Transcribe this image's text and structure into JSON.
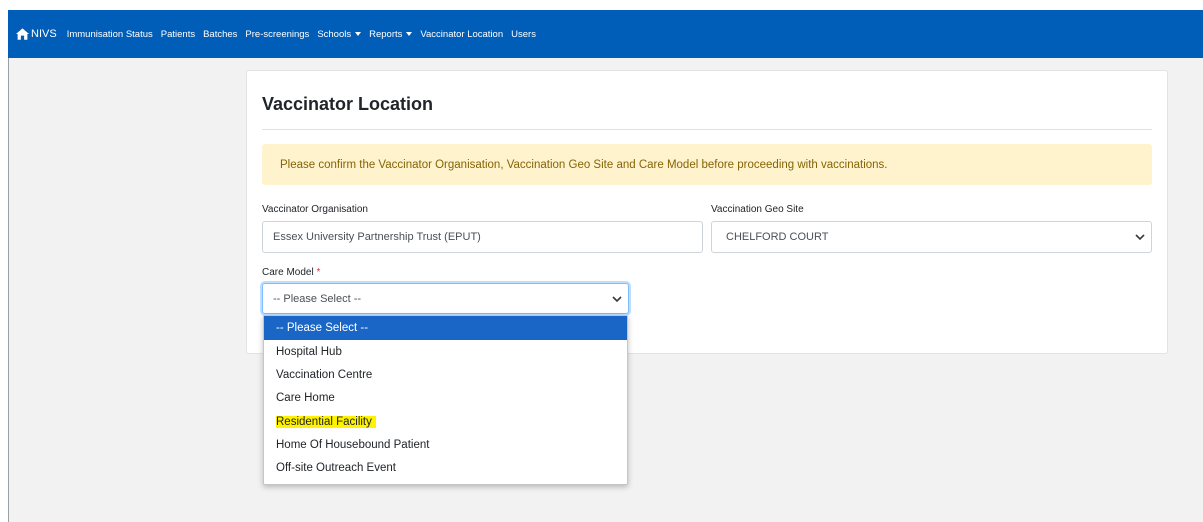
{
  "navbar": {
    "brand": "NIVS",
    "items": [
      {
        "label": "Immunisation Status",
        "dropdown": false
      },
      {
        "label": "Patients",
        "dropdown": false
      },
      {
        "label": "Batches",
        "dropdown": false
      },
      {
        "label": "Pre-screenings",
        "dropdown": false
      },
      {
        "label": "Schools",
        "dropdown": true
      },
      {
        "label": "Reports",
        "dropdown": true
      },
      {
        "label": "Vaccinator Location",
        "dropdown": false
      },
      {
        "label": "Users",
        "dropdown": false
      }
    ],
    "color": "#005eb8"
  },
  "page": {
    "title": "Vaccinator Location",
    "alert": "Please confirm the Vaccinator Organisation, Vaccination Geo Site and Care Model before proceeding with vaccinations."
  },
  "form": {
    "organisation": {
      "label": "Vaccinator Organisation",
      "value": "Essex University Partnership Trust (EPUT)"
    },
    "geo_site": {
      "label": "Vaccination Geo Site",
      "value": "CHELFORD COURT"
    },
    "care_model": {
      "label": "Care Model",
      "required_mark": "*",
      "value": "-- Please Select --",
      "options": [
        "-- Please Select --",
        "Hospital Hub",
        "Vaccination Centre",
        "Care Home",
        "Residential Facility",
        "Home Of Housebound Patient",
        "Off-site Outreach Event"
      ],
      "selected_index": 0,
      "highlighted_index": 4
    }
  },
  "icons": {
    "brand": "home-icon",
    "dropdown": "chevron-down-icon",
    "menu_caret": "caret-down-icon"
  }
}
